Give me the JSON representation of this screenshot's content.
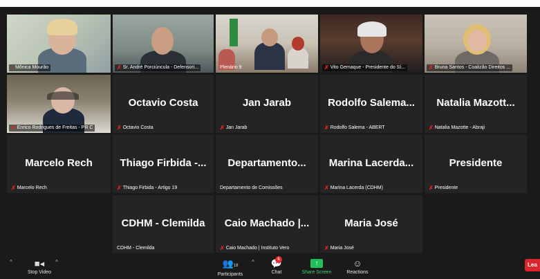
{
  "colors": {
    "background": "#1a1a1a",
    "tile": "#242424",
    "active_speaker": "#c8e13a",
    "muted": "#e22222",
    "share": "#1fbf5a",
    "leave": "#d9252b"
  },
  "tiles": [
    {
      "id": "t1",
      "label": "Mônica Mourão",
      "display_name": "",
      "video": true,
      "active": true
    },
    {
      "id": "t2",
      "label": "Sr. André Porciúncula - Defensori...",
      "display_name": "",
      "video": true
    },
    {
      "id": "t3",
      "label": "Plenário 9",
      "display_name": "",
      "video": true
    },
    {
      "id": "t4",
      "label": "Vito Gemaque - Presidente do Sí...",
      "display_name": "",
      "video": true
    },
    {
      "id": "t5",
      "label": "Bruna Santos - Coalizão Direitos ...",
      "display_name": "",
      "video": true
    },
    {
      "id": "t6",
      "label": "Enrico Rodrigues de Freitas - PR C",
      "display_name": "",
      "video": true
    },
    {
      "id": "t7",
      "label": "Octavio Costa",
      "display_name": "Octavio Costa"
    },
    {
      "id": "t8",
      "label": "Jan Jarab",
      "display_name": "Jan Jarab"
    },
    {
      "id": "t9",
      "label": "Rodolfo Salema - ABERT",
      "display_name": "Rodolfo Salema..."
    },
    {
      "id": "t10",
      "label": "Natalia Mazotte - Abraji",
      "display_name": "Natalia Mazott..."
    },
    {
      "id": "t11",
      "label": "Marcelo Rech",
      "display_name": "Marcelo Rech"
    },
    {
      "id": "t12",
      "label": "Thiago Firbida - Artigo 19",
      "display_name": "Thiago Firbida -..."
    },
    {
      "id": "t13",
      "label": "Departamento de Comissões",
      "display_name": "Departamento..."
    },
    {
      "id": "t14",
      "label": "Marina Lacerda (CDHM)",
      "display_name": "Marina Lacerda..."
    },
    {
      "id": "t15",
      "label": "Presidente",
      "display_name": "Presidente"
    },
    {
      "id": "t16",
      "label": "CDHM - Clemilda",
      "display_name": "CDHM - Clemilda"
    },
    {
      "id": "t17",
      "label": "Caio Machado | Instituto Vero",
      "display_name": "Caio Machado |..."
    },
    {
      "id": "t18",
      "label": "Maria José",
      "display_name": "Maria José"
    }
  ],
  "toolbar": {
    "stop_video": "Stop Video",
    "participants": "Participants",
    "participants_count": "18",
    "chat": "Chat",
    "chat_badge": "6",
    "share_screen": "Share Screen",
    "reactions": "Reactions",
    "leave": "Lea"
  }
}
